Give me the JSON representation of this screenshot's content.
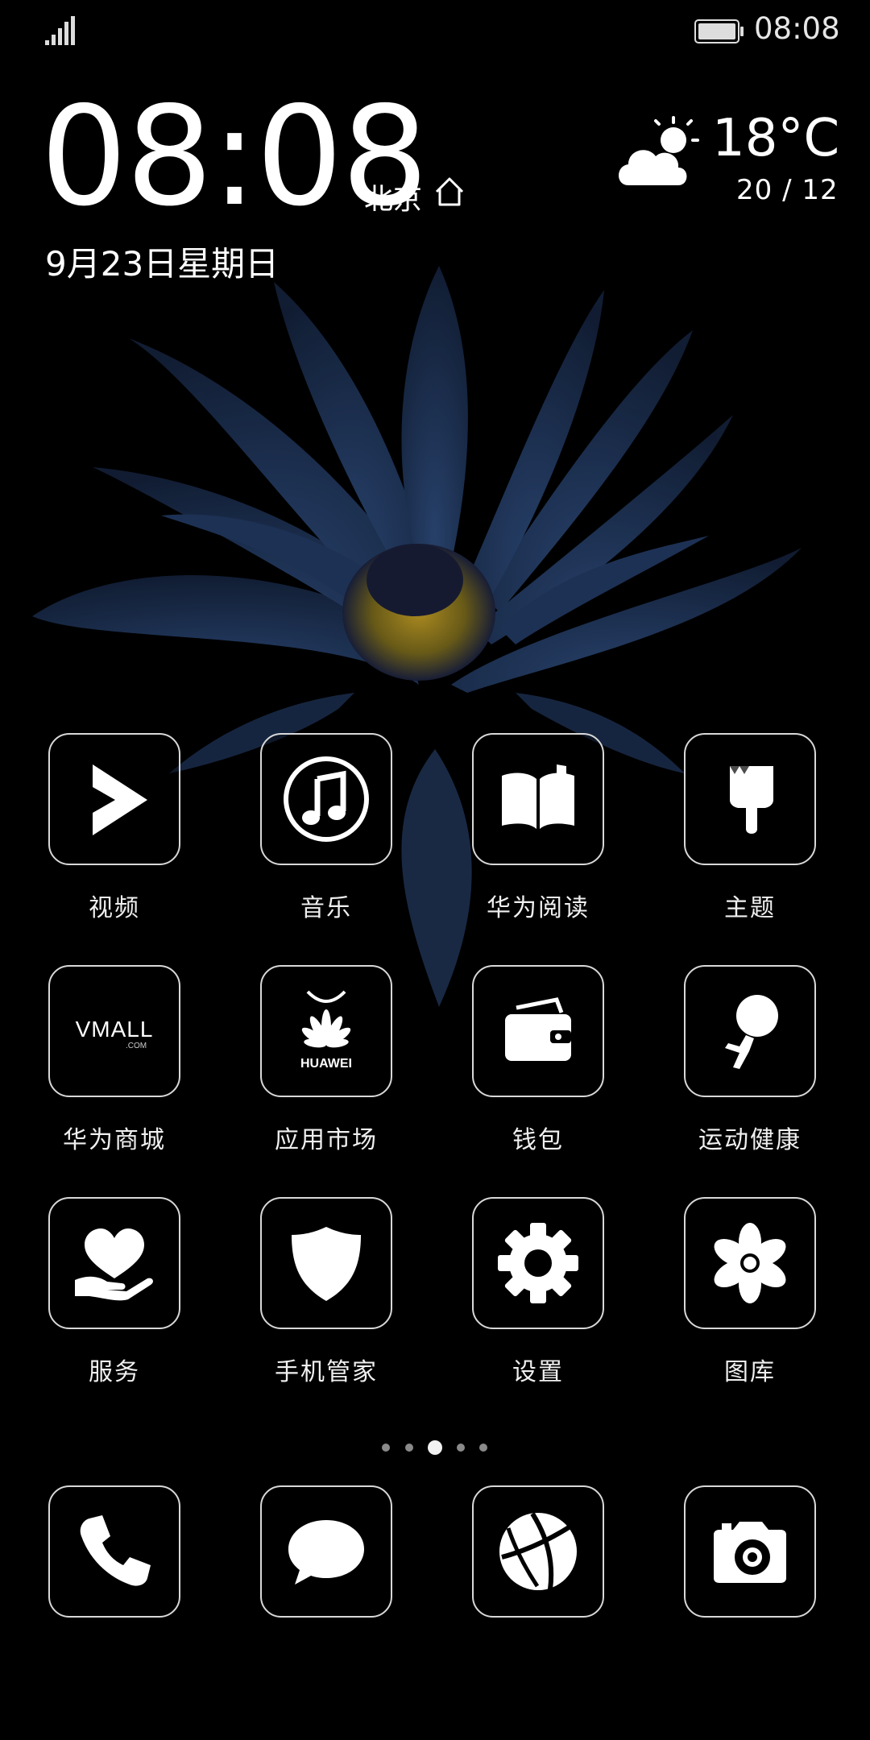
{
  "status_bar": {
    "time": "08:08"
  },
  "clock_widget": {
    "time": "08:08",
    "city": "北京",
    "date": "9月23日星期日"
  },
  "weather": {
    "temperature": "18°C",
    "range": "20 / 12",
    "icon": "partly-cloudy-icon"
  },
  "apps": [
    {
      "label": "视频",
      "icon": "video-play-icon"
    },
    {
      "label": "音乐",
      "icon": "music-note-icon"
    },
    {
      "label": "华为阅读",
      "icon": "book-icon"
    },
    {
      "label": "主题",
      "icon": "paintbrush-icon"
    },
    {
      "label": "华为商城",
      "icon": "vmall-logo-icon",
      "logo_text": "VMALL",
      "logo_sub": ".COM"
    },
    {
      "label": "应用市场",
      "icon": "huawei-appgallery-icon",
      "logo_text": "HUAWEI"
    },
    {
      "label": "钱包",
      "icon": "wallet-icon"
    },
    {
      "label": "运动健康",
      "icon": "fitness-runner-icon"
    },
    {
      "label": "服务",
      "icon": "heart-hand-icon"
    },
    {
      "label": "手机管家",
      "icon": "shield-icon"
    },
    {
      "label": "设置",
      "icon": "gear-icon"
    },
    {
      "label": "图库",
      "icon": "flower-icon"
    }
  ],
  "page_indicator": {
    "total": 5,
    "active_index": 2
  },
  "dock": [
    {
      "icon": "phone-icon"
    },
    {
      "icon": "message-bubble-icon"
    },
    {
      "icon": "browser-globe-icon"
    },
    {
      "icon": "camera-icon"
    }
  ]
}
